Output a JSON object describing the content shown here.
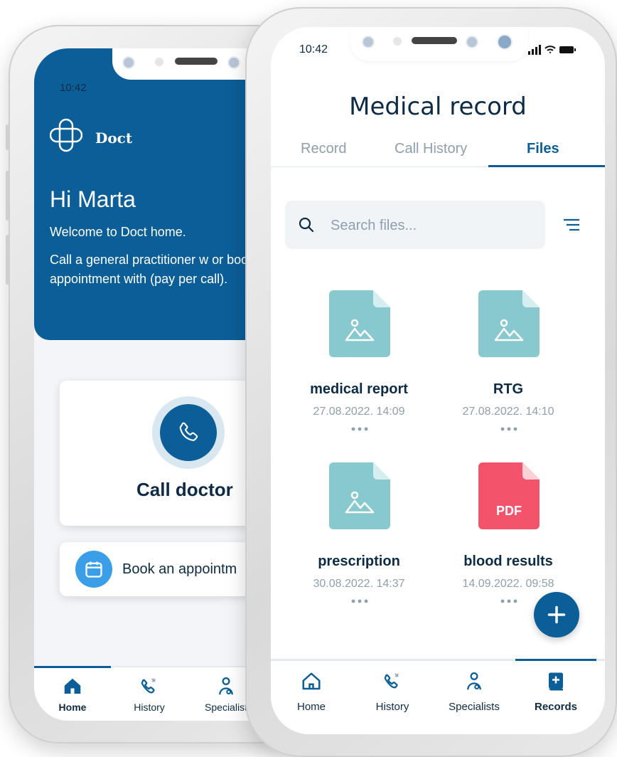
{
  "colors": {
    "primary": "#0b5e98",
    "dark_text": "#0d2b45",
    "muted_text": "#8e9fae",
    "image_file": "#88c9cf",
    "pdf_file": "#f3546c",
    "calendar_accent": "#3a9ee8"
  },
  "home_screen": {
    "status_time": "10:42",
    "brand": "Doct",
    "greeting": "Hi Marta",
    "welcome": "Welcome to Doct home.",
    "description": "Call a general practitioner w or book an appointment with (pay per call).",
    "call_card": {
      "label": "Call doctor",
      "icon": "phone-icon"
    },
    "book_card": {
      "label": "Book an appointm",
      "icon": "calendar-icon"
    },
    "nav": [
      {
        "label": "Home",
        "icon": "home-icon",
        "active": true
      },
      {
        "label": "History",
        "icon": "call-history-icon",
        "active": false
      },
      {
        "label": "Specialist",
        "icon": "specialist-icon",
        "active": false
      }
    ]
  },
  "records_screen": {
    "status_time": "10:42",
    "title": "Medical record",
    "tabs": [
      {
        "label": "Record",
        "active": false
      },
      {
        "label": "Call History",
        "active": false
      },
      {
        "label": "Files",
        "active": true
      }
    ],
    "search": {
      "placeholder": "Search files...",
      "icon": "search-icon"
    },
    "filter_icon": "filter-list-icon",
    "files": [
      {
        "name": "medical report",
        "date": "27.08.2022. 14:09",
        "type": "image"
      },
      {
        "name": "RTG",
        "date": "27.08.2022. 14:10",
        "type": "image"
      },
      {
        "name": "prescription",
        "date": "30.08.2022. 14:37",
        "type": "image"
      },
      {
        "name": "blood results",
        "date": "14.09.2022. 09:58",
        "type": "pdf",
        "badge": "PDF"
      }
    ],
    "fab_icon": "plus-icon",
    "nav": [
      {
        "label": "Home",
        "icon": "home-icon",
        "active": false
      },
      {
        "label": "History",
        "icon": "call-history-icon",
        "active": false
      },
      {
        "label": "Specialists",
        "icon": "specialist-icon",
        "active": false
      },
      {
        "label": "Records",
        "icon": "records-icon",
        "active": true
      }
    ]
  }
}
